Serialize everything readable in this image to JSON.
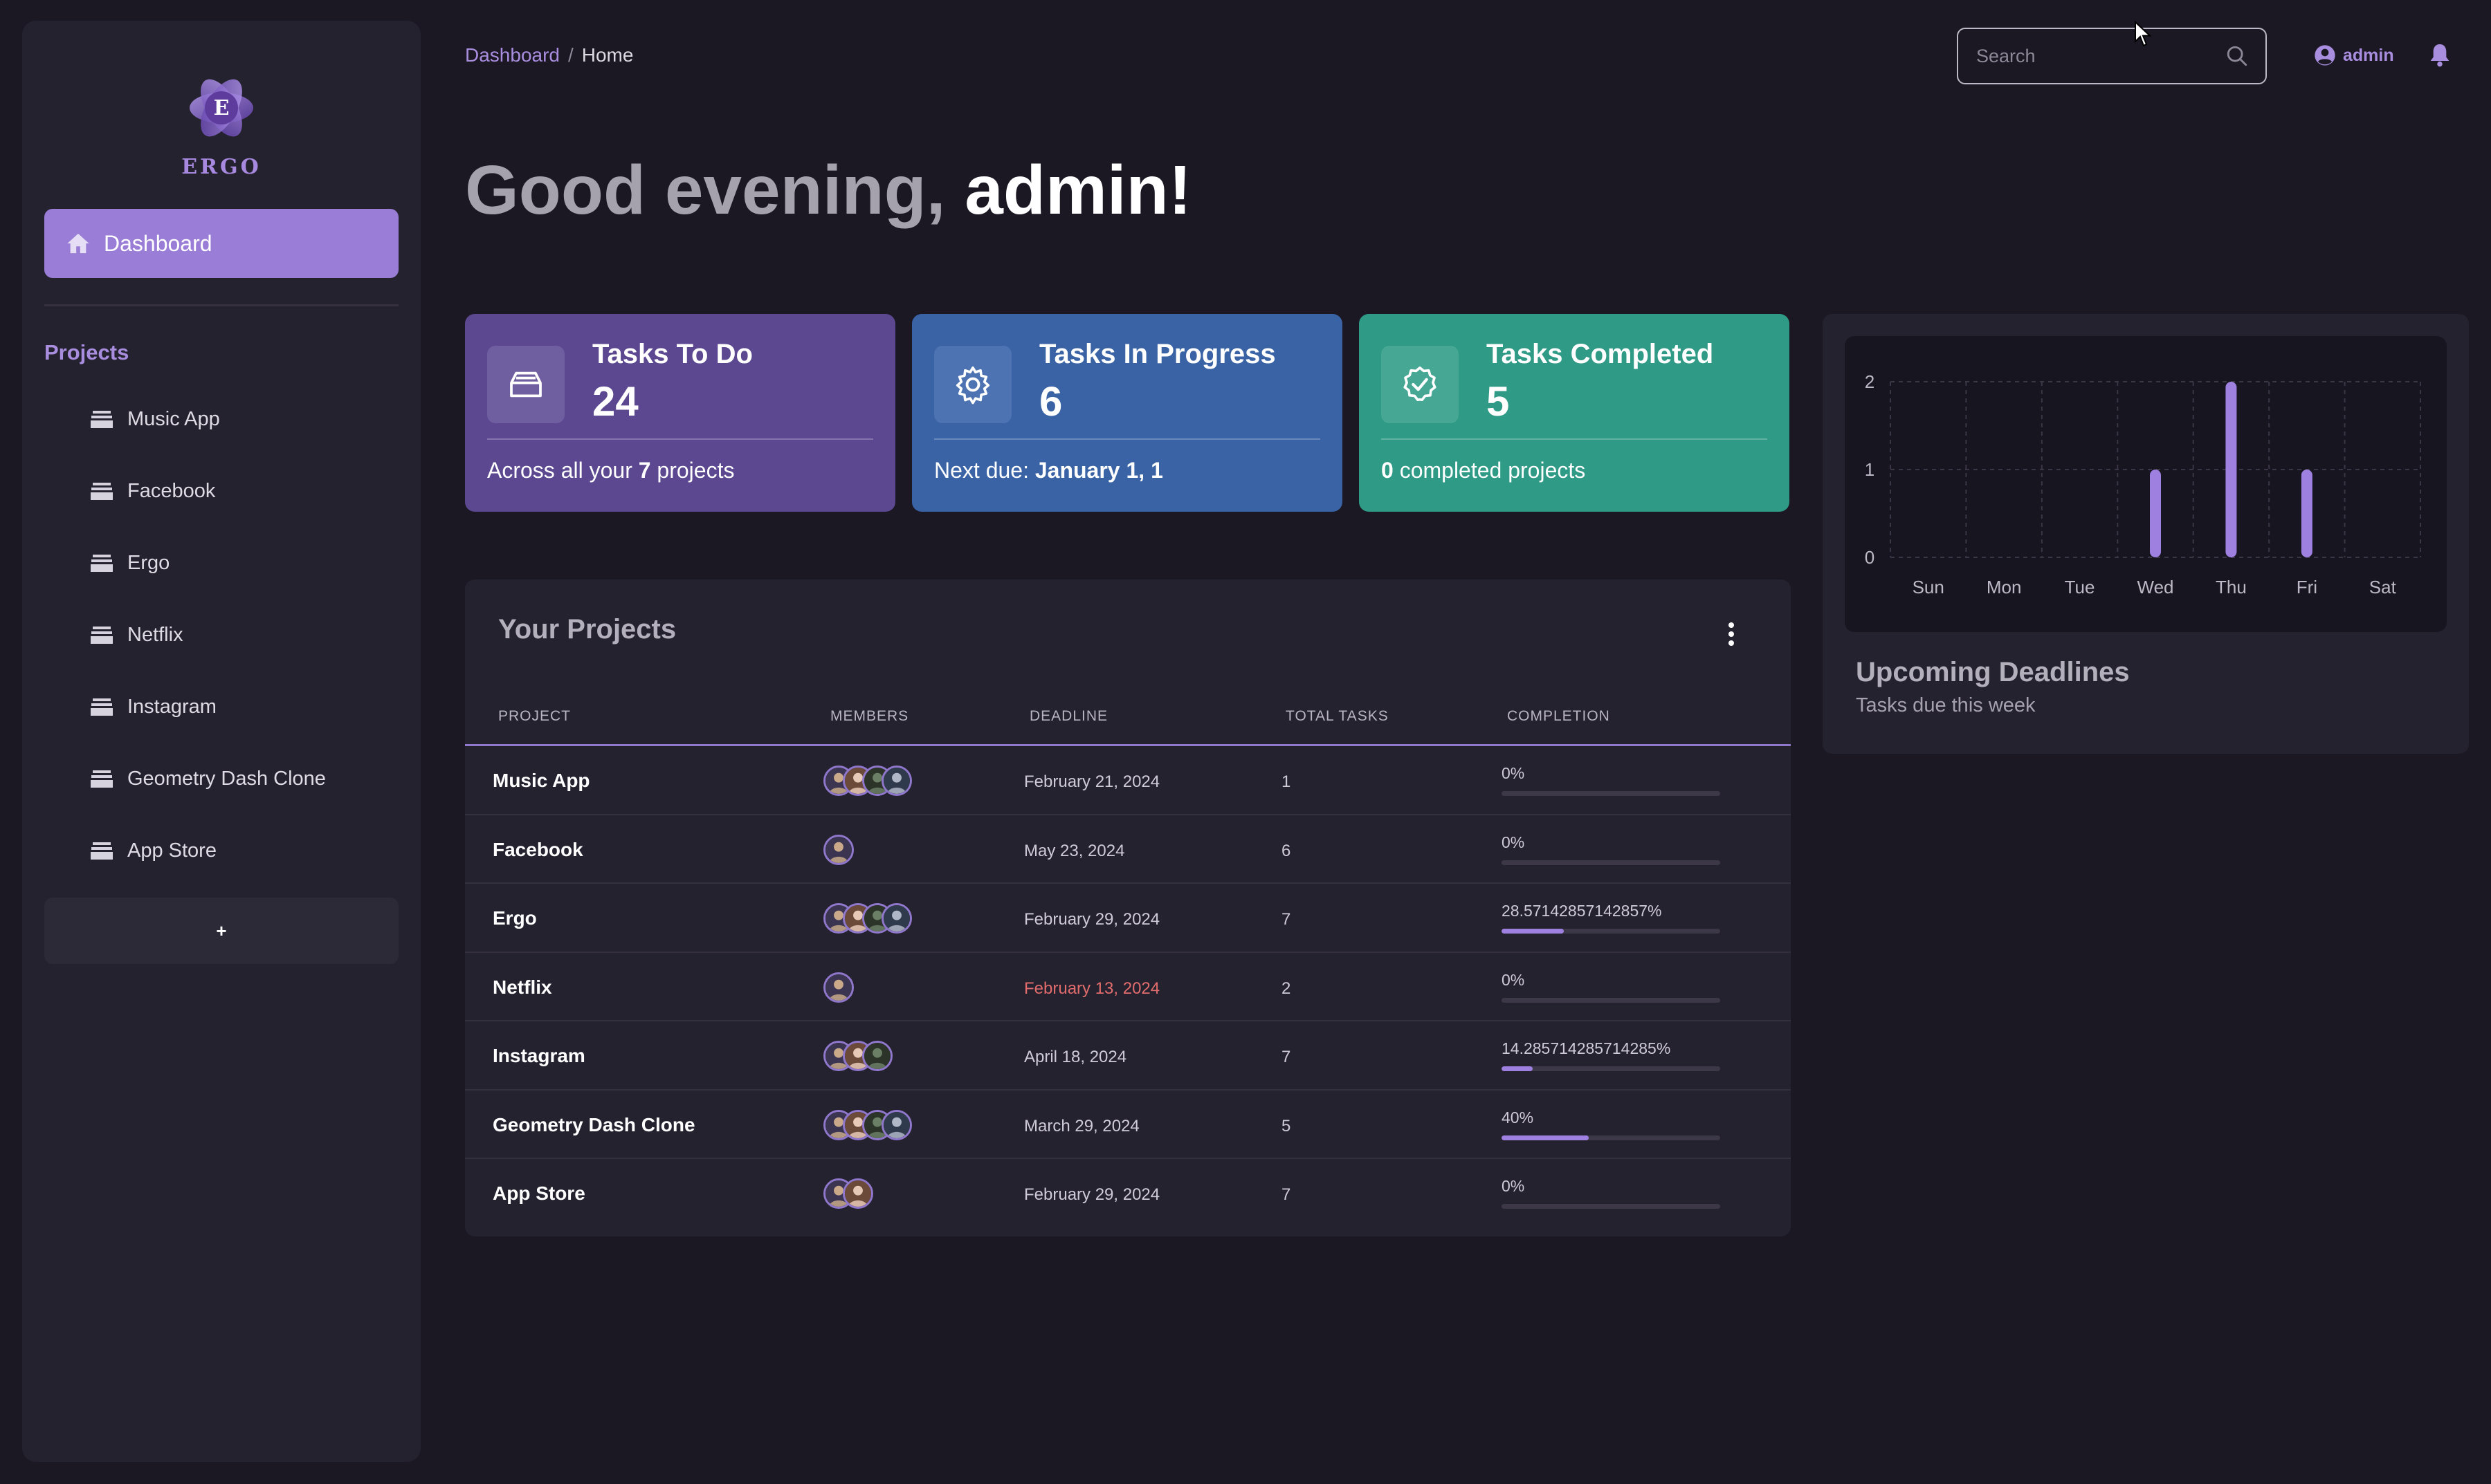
{
  "brand": {
    "name": "ERGO",
    "logo_letter": "E"
  },
  "sidebar": {
    "dashboard_label": "Dashboard",
    "projects_heading": "Projects",
    "projects": [
      {
        "label": "Music App"
      },
      {
        "label": "Facebook"
      },
      {
        "label": "Ergo"
      },
      {
        "label": "Netflix"
      },
      {
        "label": "Instagram"
      },
      {
        "label": "Geometry Dash Clone"
      },
      {
        "label": "App Store"
      }
    ],
    "add_label": "+"
  },
  "header": {
    "breadcrumb": {
      "root": "Dashboard",
      "separator": "/",
      "current": "Home"
    },
    "search_placeholder": "Search",
    "username": "admin"
  },
  "greeting": {
    "prefix": "Good evening,",
    "name": "admin!"
  },
  "stats": {
    "todo": {
      "title": "Tasks To Do",
      "value": "24",
      "foot_pre": "Across all your",
      "foot_bold": "7",
      "foot_post": "projects"
    },
    "in_progress": {
      "title": "Tasks In Progress",
      "value": "6",
      "foot_pre": "Next due:",
      "foot_bold": "January 1, 1"
    },
    "completed": {
      "title": "Tasks Completed",
      "value": "5",
      "foot_bold": "0",
      "foot_post": "completed projects"
    }
  },
  "projects_table": {
    "title": "Your Projects",
    "columns": {
      "project": "PROJECT",
      "members": "MEMBERS",
      "deadline": "DEADLINE",
      "total_tasks": "TOTAL TASKS",
      "completion": "COMPLETION"
    },
    "rows": [
      {
        "name": "Music App",
        "members": 4,
        "deadline": "February 21, 2024",
        "overdue": false,
        "tasks": "1",
        "completion_label": "0%",
        "completion": 0
      },
      {
        "name": "Facebook",
        "members": 1,
        "deadline": "May 23, 2024",
        "overdue": false,
        "tasks": "6",
        "completion_label": "0%",
        "completion": 0
      },
      {
        "name": "Ergo",
        "members": 4,
        "deadline": "February 29, 2024",
        "overdue": false,
        "tasks": "7",
        "completion_label": "28.57142857142857%",
        "completion": 28.57142857142857
      },
      {
        "name": "Netflix",
        "members": 1,
        "deadline": "February 13, 2024",
        "overdue": true,
        "tasks": "2",
        "completion_label": "0%",
        "completion": 0
      },
      {
        "name": "Instagram",
        "members": 3,
        "deadline": "April 18, 2024",
        "overdue": false,
        "tasks": "7",
        "completion_label": "14.285714285714285%",
        "completion": 14.285714285714285
      },
      {
        "name": "Geometry Dash Clone",
        "members": 4,
        "deadline": "March 29, 2024",
        "overdue": false,
        "tasks": "5",
        "completion_label": "40%",
        "completion": 40
      },
      {
        "name": "App Store",
        "members": 2,
        "deadline": "February 29, 2024",
        "overdue": false,
        "tasks": "7",
        "completion_label": "0%",
        "completion": 0
      }
    ]
  },
  "deadlines": {
    "title": "Upcoming Deadlines",
    "subtitle": "Tasks due this week"
  },
  "chart_data": {
    "type": "bar",
    "categories": [
      "Sun",
      "Mon",
      "Tue",
      "Wed",
      "Thu",
      "Fri",
      "Sat"
    ],
    "values": [
      0,
      0,
      0,
      1,
      2,
      1,
      0
    ],
    "yticks": [
      0,
      1,
      2
    ],
    "ylim": [
      0,
      2
    ],
    "grid": true,
    "xlabel": "",
    "ylabel": "",
    "title": ""
  },
  "colors": {
    "accent": "#9a7dd6",
    "todo_card": "#5b4890",
    "progress_card": "#3a63a5",
    "completed_card": "#2f9a85",
    "overdue": "#e06c6c",
    "bar": "#9d80e0"
  },
  "icons": {
    "dashboard": "home-icon",
    "project": "stack-icon",
    "search": "search-icon",
    "user": "user-circle-icon",
    "notifications": "bell-icon",
    "todo": "inbox-icon",
    "progress": "gear-icon",
    "completed": "check-badge-icon",
    "more": "more-vertical-icon"
  }
}
